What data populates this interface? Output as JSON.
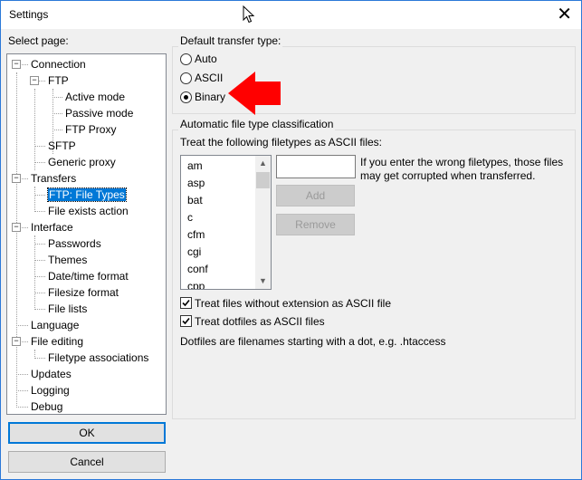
{
  "window": {
    "title": "Settings",
    "close_glyph": "✕",
    "accent": "#0078d7"
  },
  "left": {
    "select_page_label": "Select page:"
  },
  "tree": [
    {
      "label": "Connection",
      "level": 0,
      "toggle": "−"
    },
    {
      "label": "FTP",
      "level": 1,
      "toggle": "−"
    },
    {
      "label": "Active mode",
      "level": 2
    },
    {
      "label": "Passive mode",
      "level": 2
    },
    {
      "label": "FTP Proxy",
      "level": 2
    },
    {
      "label": "SFTP",
      "level": 1
    },
    {
      "label": "Generic proxy",
      "level": 1
    },
    {
      "label": "Transfers",
      "level": 0,
      "toggle": "−"
    },
    {
      "label": "FTP: File Types",
      "level": 1,
      "selected": true
    },
    {
      "label": "File exists action",
      "level": 1
    },
    {
      "label": "Interface",
      "level": 0,
      "toggle": "−"
    },
    {
      "label": "Passwords",
      "level": 1
    },
    {
      "label": "Themes",
      "level": 1
    },
    {
      "label": "Date/time format",
      "level": 1
    },
    {
      "label": "Filesize format",
      "level": 1
    },
    {
      "label": "File lists",
      "level": 1
    },
    {
      "label": "Language",
      "level": 0
    },
    {
      "label": "File editing",
      "level": 0,
      "toggle": "−"
    },
    {
      "label": "Filetype associations",
      "level": 1
    },
    {
      "label": "Updates",
      "level": 0
    },
    {
      "label": "Logging",
      "level": 0
    },
    {
      "label": "Debug",
      "level": 0
    }
  ],
  "buttons": {
    "ok": "OK",
    "cancel": "Cancel",
    "add": "Add",
    "remove": "Remove"
  },
  "transfer_type": {
    "legend": "Default transfer type:",
    "options": [
      "Auto",
      "ASCII",
      "Binary"
    ],
    "selected": "Binary"
  },
  "classification": {
    "legend": "Automatic file type classification",
    "treat_label": "Treat the following filetypes as ASCII files:",
    "extensions": [
      "am",
      "asp",
      "bat",
      "c",
      "cfm",
      "cgi",
      "conf",
      "cpp"
    ],
    "new_extension_value": "",
    "warning": "If you enter the wrong filetypes, those files may get corrupted when transferred.",
    "check_no_extension": "Treat files without extension as ASCII file",
    "check_no_extension_checked": true,
    "check_dotfiles": "Treat dotfiles as ASCII files",
    "check_dotfiles_checked": true,
    "dotfiles_note": "Dotfiles are filenames starting with a dot, e.g. .htaccess"
  },
  "annotation": {
    "arrow_color": "#ff0000"
  }
}
